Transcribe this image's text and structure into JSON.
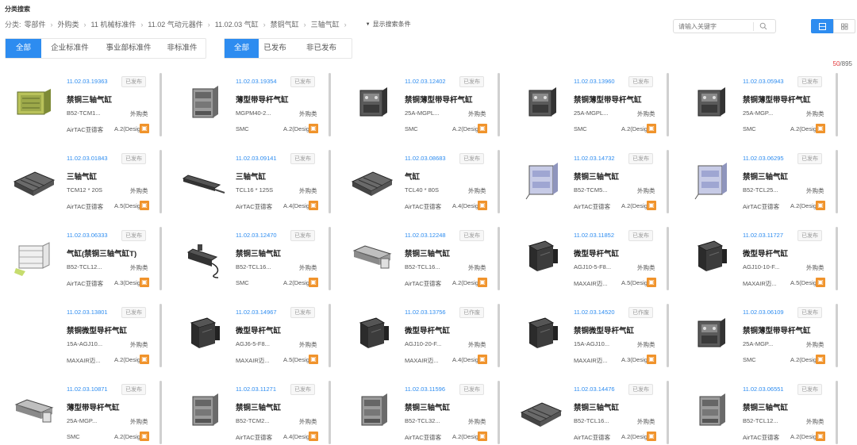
{
  "page_title": "分类搜索",
  "breadcrumb": {
    "prefix": "分类:",
    "items": [
      "零部件",
      "外购类",
      "11 机械标准件",
      "11.02 气动元器件",
      "11.02.03 气缸",
      "禁铜气缸",
      "三轴气缸"
    ],
    "toggle_label": "显示搜索条件"
  },
  "search": {
    "placeholder": "请输入关键字"
  },
  "tabs_standard": [
    "全部",
    "企业标准件",
    "事业部标准件",
    "非标准件"
  ],
  "tabs_status": [
    "全部",
    "已发布",
    "非已发布"
  ],
  "pager": {
    "current": "50",
    "total": "/895"
  },
  "colors": {
    "accent": "#2d8cf0",
    "badge": "#f0932b",
    "pager_current": "#e4393c"
  },
  "cards": [
    {
      "code": "11.02.03.19363",
      "status": "已发布",
      "name": "禁铜三轴气缸",
      "model": "B52-TCM1...",
      "category": "外购类",
      "brand": "AirTAC亚德客",
      "version": "A.2(Design)",
      "image": "yellow-green-cylinder-icon"
    },
    {
      "code": "11.02.03.19354",
      "status": "已发布",
      "name": "薄型带导杆气缸",
      "model": "MGPM40-2...",
      "category": "外购类",
      "brand": "SMC",
      "version": "A.2(Design)",
      "image": "grey-guided-cylinder-icon"
    },
    {
      "code": "11.02.03.12402",
      "status": "已发布",
      "name": "禁铜薄型带导杆气缸",
      "model": "25A-MGPL...",
      "category": "外购类",
      "brand": "SMC",
      "version": "A.2(Design)",
      "image": "dark-guided-cylinder-icon"
    },
    {
      "code": "11.02.03.13960",
      "status": "已发布",
      "name": "禁铜薄型带导杆气缸",
      "model": "25A-MGPL...",
      "category": "外购类",
      "brand": "SMC",
      "version": "A.2(Design)",
      "image": "dark-guided-cylinder-icon"
    },
    {
      "code": "11.02.03.05943",
      "status": "已发布",
      "name": "禁铜薄型带导杆气缸",
      "model": "25A-MGP...",
      "category": "外购类",
      "brand": "SMC",
      "version": "A.2(Design)",
      "image": "dark-guided-cylinder-icon"
    },
    {
      "code": "11.02.03.01843",
      "status": "已发布",
      "name": "三轴气缸",
      "model": "TCM12 * 20S",
      "category": "外购类",
      "brand": "AirTAC亚德客",
      "version": "A.5(Design)",
      "image": "flat-tri-rod-cylinder-icon"
    },
    {
      "code": "11.02.03.09141",
      "status": "已发布",
      "name": "三轴气缸",
      "model": "TCL16 * 125S",
      "category": "外购类",
      "brand": "AirTAC亚德客",
      "version": "A.4(Design)",
      "image": "long-slim-cylinder-icon"
    },
    {
      "code": "11.02.03.08683",
      "status": "已发布",
      "name": "气缸",
      "model": "TCL40 * 80S",
      "category": "外购类",
      "brand": "AirTAC亚德客",
      "version": "A.4(Design)",
      "image": "flat-tri-rod-cylinder-icon"
    },
    {
      "code": "11.02.03.14732",
      "status": "已发布",
      "name": "禁铜三轴气缸",
      "model": "B52-TCM5...",
      "category": "外购类",
      "brand": "AirTAC亚德客",
      "version": "A.2(Design)",
      "image": "blue-tri-rod-cylinder-icon"
    },
    {
      "code": "11.02.03.06295",
      "status": "已发布",
      "name": "禁铜三轴气缸",
      "model": "B52-TCL25...",
      "category": "外购类",
      "brand": "AirTAC亚德客",
      "version": "A.2(Design)",
      "image": "blue-tri-rod-cylinder-icon"
    },
    {
      "code": "11.02.03.06333",
      "status": "已发布",
      "name": "气缸(禁铜三轴气缸T)",
      "model": "B52-TCL12...",
      "category": "外购类",
      "brand": "AirTAC亚德客",
      "version": "A.3(Design)",
      "image": "wireframe-cylinder-icon"
    },
    {
      "code": "11.02.03.12470",
      "status": "已发布",
      "name": "禁铜三轴气缸",
      "model": "B52-TCL16...",
      "category": "外购类",
      "brand": "SMC",
      "version": "A.2(Design)",
      "image": "cabled-cylinder-icon"
    },
    {
      "code": "11.02.03.12248",
      "status": "已发布",
      "name": "禁铜三轴气缸",
      "model": "B52-TCL16...",
      "category": "外购类",
      "brand": "AirTAC亚德客",
      "version": "A.2(Design)",
      "image": "long-rod-cylinder-icon"
    },
    {
      "code": "11.02.03.11852",
      "status": "已发布",
      "name": "微型导杆气缸",
      "model": "AGJ10-5-F8...",
      "category": "外购类",
      "brand": "MAXAIR迈...",
      "version": "A.5(Design)",
      "image": "black-mini-guided-cylinder-icon"
    },
    {
      "code": "11.02.03.11727",
      "status": "已发布",
      "name": "微型导杆气缸",
      "model": "AGJ10-10-F...",
      "category": "外购类",
      "brand": "MAXAIR迈...",
      "version": "A.5(Design)",
      "image": "black-mini-guided-cylinder-icon"
    },
    {
      "code": "11.02.03.13801",
      "status": "已发布",
      "name": "禁铜微型导杆气缸",
      "model": "15A-AGJ10...",
      "category": "外购类",
      "brand": "MAXAIR迈...",
      "version": "A.2(Design)",
      "image": "blank-image-icon"
    },
    {
      "code": "11.02.03.14967",
      "status": "已发布",
      "name": "微型导杆气缸",
      "model": "AGJ6-5-F8...",
      "category": "外购类",
      "brand": "MAXAIR迈...",
      "version": "A.5(Design)",
      "image": "black-mini-guided-cylinder-icon"
    },
    {
      "code": "11.02.03.13756",
      "status": "已作废",
      "name": "微型导杆气缸",
      "model": "AGJ10-20-F...",
      "category": "外购类",
      "brand": "MAXAIR迈...",
      "version": "A.4(Design)",
      "image": "black-mini-guided-cylinder-icon"
    },
    {
      "code": "11.02.03.14520",
      "status": "已作废",
      "name": "禁铜微型导杆气缸",
      "model": "15A-AGJ10...",
      "category": "外购类",
      "brand": "MAXAIR迈...",
      "version": "A.3(Design)",
      "image": "black-mini-guided-cylinder-icon"
    },
    {
      "code": "11.02.03.06109",
      "status": "已发布",
      "name": "禁铜薄型带导杆气缸",
      "model": "25A-MGP...",
      "category": "外购类",
      "brand": "SMC",
      "version": "A.2(Design)",
      "image": "dark-guided-cylinder-icon"
    },
    {
      "code": "11.02.03.10871",
      "status": "已发布",
      "name": "薄型带导杆气缸",
      "model": "25A-MGP...",
      "category": "外购类",
      "brand": "SMC",
      "version": "A.2(Design)",
      "image": "long-rod-cylinder-icon"
    },
    {
      "code": "11.02.03.11271",
      "status": "已发布",
      "name": "禁铜三轴气缸",
      "model": "B52-TCM2...",
      "category": "外购类",
      "brand": "AirTAC亚德客",
      "version": "A.4(Design)",
      "image": "grey-guided-cylinder-icon"
    },
    {
      "code": "11.02.03.11596",
      "status": "已发布",
      "name": "禁铜三轴气缸",
      "model": "B52-TCL32...",
      "category": "外购类",
      "brand": "AirTAC亚德客",
      "version": "A.2(Design)",
      "image": "grey-guided-cylinder-icon"
    },
    {
      "code": "11.02.03.14476",
      "status": "已发布",
      "name": "禁铜三轴气缸",
      "model": "B52-TCL16...",
      "category": "外购类",
      "brand": "AirTAC亚德客",
      "version": "A.2(Design)",
      "image": "flat-tri-rod-cylinder-icon"
    },
    {
      "code": "11.02.03.06551",
      "status": "已发布",
      "name": "禁铜三轴气缸",
      "model": "B52-TCL12...",
      "category": "外购类",
      "brand": "AirTAC亚德客",
      "version": "A.2(Design)",
      "image": "grey-guided-cylinder-icon"
    }
  ]
}
